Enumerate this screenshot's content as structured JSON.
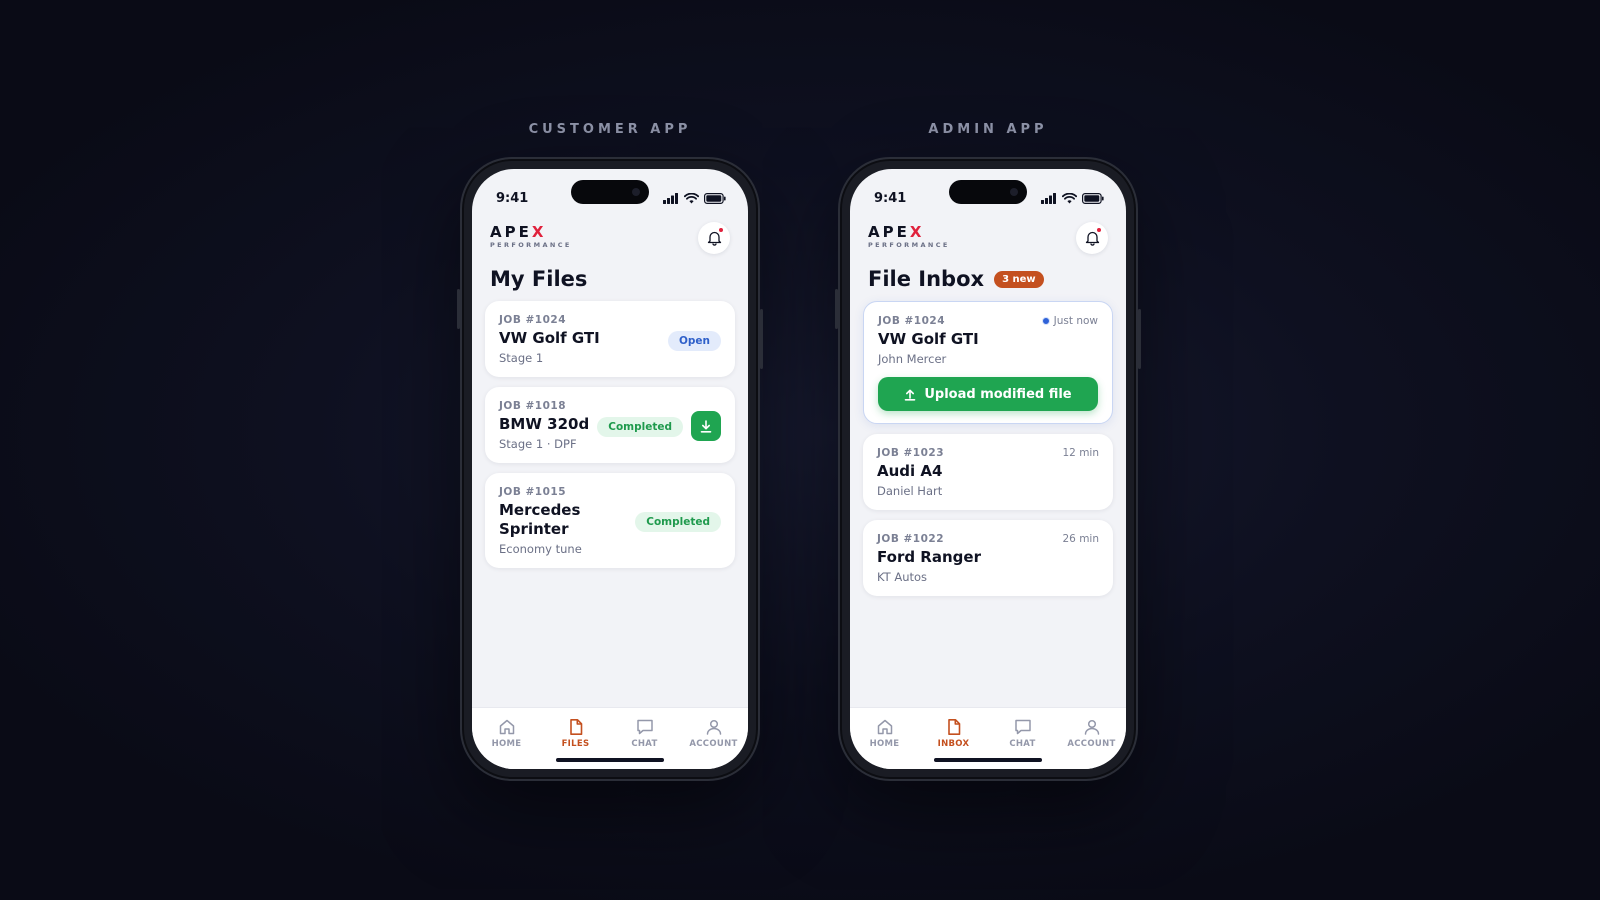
{
  "customer": {
    "label": "CUSTOMER APP",
    "status_time": "9:41",
    "logo": {
      "word_main": "APE",
      "word_accent": "X",
      "sub": "PERFORMANCE"
    },
    "title": "My Files",
    "cards": [
      {
        "job": "JOB #1024",
        "vehicle": "VW Golf GTI",
        "detail": "Stage 1",
        "status": "Open"
      },
      {
        "job": "JOB #1018",
        "vehicle": "BMW 320d",
        "detail": "Stage 1 · DPF",
        "status": "Completed",
        "action_icon": "download-icon"
      },
      {
        "job": "JOB #1015",
        "vehicle": "Mercedes Sprinter",
        "detail": "Economy tune",
        "status": "Completed"
      }
    ],
    "tabs": [
      {
        "label": "HOME",
        "icon": "home-icon"
      },
      {
        "label": "FILES",
        "icon": "file-icon",
        "active": true
      },
      {
        "label": "CHAT",
        "icon": "chat-icon"
      },
      {
        "label": "ACCOUNT",
        "icon": "user-icon"
      }
    ]
  },
  "admin": {
    "label": "ADMIN APP",
    "status_time": "9:41",
    "logo": {
      "word_main": "APE",
      "word_accent": "X",
      "sub": "PERFORMANCE"
    },
    "title": "File Inbox",
    "new_badge": "3 new",
    "cards": [
      {
        "job": "JOB #1024",
        "vehicle": "VW Golf GTI",
        "customer": "John Mercer",
        "time": "Just now",
        "action": "Upload modified file"
      },
      {
        "job": "JOB #1023",
        "vehicle": "Audi A4",
        "customer": "Daniel Hart",
        "time": "12 min"
      },
      {
        "job": "JOB #1022",
        "vehicle": "Ford Ranger",
        "customer": "KT Autos",
        "time": "26 min"
      }
    ],
    "tabs": [
      {
        "label": "HOME",
        "icon": "home-icon"
      },
      {
        "label": "INBOX",
        "icon": "file-icon",
        "active": true
      },
      {
        "label": "CHAT",
        "icon": "chat-icon"
      },
      {
        "label": "ACCOUNT",
        "icon": "user-icon"
      }
    ]
  },
  "colors": {
    "accent": "#c4501f",
    "brand_red": "#e0213c",
    "success": "#1fa551",
    "info": "#2e5fc9",
    "background": "#0e1020"
  }
}
